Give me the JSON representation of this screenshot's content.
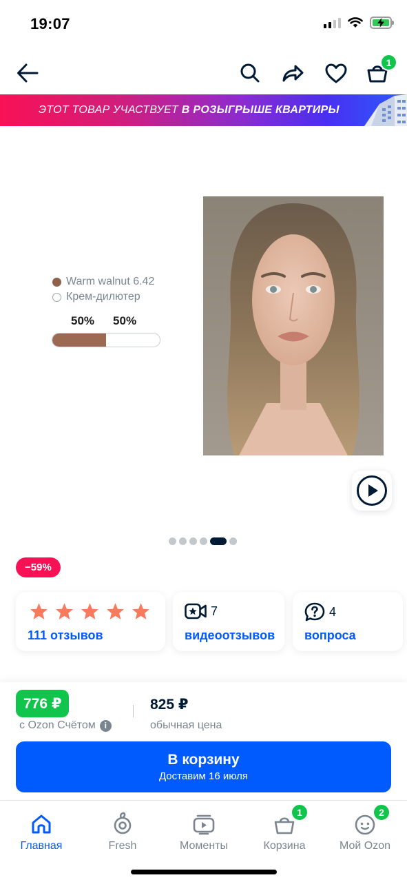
{
  "status_bar": {
    "time": "19:07"
  },
  "toolbar": {
    "back_icon": "arrow-left-icon",
    "search_icon": "search-icon",
    "share_icon": "share-icon",
    "favorite_icon": "heart-icon",
    "cart_icon": "cart-icon",
    "cart_count": "1"
  },
  "promo": {
    "text_regular": "ЭТОТ ТОВАР УЧАСТВУЕТ",
    "text_bold": "В РОЗЫГРЫШЕ КВАРТИРЫ"
  },
  "gallery": {
    "legend": [
      {
        "label": "Warm walnut 6.42",
        "color": "#8e5f4b"
      },
      {
        "label": "Крем-дилютер",
        "color": "#ffffff"
      }
    ],
    "ratio_left": "50%",
    "ratio_right": "50%",
    "ratio_fill": 0.5,
    "photo_icon": "product-model-photo",
    "video_icon": "play-icon",
    "pages_total": 6,
    "page_active": 5
  },
  "discount": {
    "label": "−59%"
  },
  "reviews": {
    "rating_stars": 5,
    "reviews_link": "111 отзывов",
    "video_count": "7",
    "video_link": "видеоотзывов",
    "questions_count": "4",
    "questions_link": "вопроса"
  },
  "price": {
    "card_price": "776 ₽",
    "card_price_note": "с Ozon Счётом",
    "regular_price": "825 ₽",
    "regular_price_note": "обычная цена"
  },
  "cart_button": {
    "label": "В корзину",
    "delivery": "Доставим 16 июля"
  },
  "tabbar": {
    "items": [
      {
        "label": "Главная",
        "icon": "home-icon",
        "active": true
      },
      {
        "label": "Fresh",
        "icon": "fresh-icon"
      },
      {
        "label": "Моменты",
        "icon": "moments-icon"
      },
      {
        "label": "Корзина",
        "icon": "cart-icon",
        "badge": "1"
      },
      {
        "label": "Мой Ozon",
        "icon": "profile-icon",
        "badge": "2"
      }
    ]
  },
  "colors": {
    "accent": "#005bff",
    "green": "#10c44c",
    "discount": "#f91155",
    "star": "#f97a5c"
  }
}
